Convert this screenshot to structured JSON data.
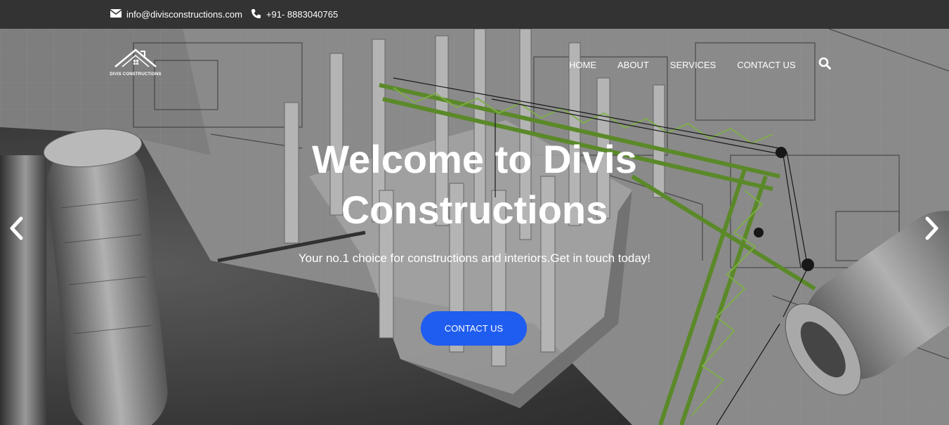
{
  "topbar": {
    "email": "info@divisconstructions.com",
    "phone": "+91- 8883040765",
    "email_icon": "envelope-icon",
    "phone_icon": "phone-icon"
  },
  "logo": {
    "text": "DIVIS CONSTRUCTIONS"
  },
  "nav": {
    "items": [
      "HOME",
      "ABOUT",
      "SERVICES",
      "CONTACT US"
    ],
    "search_icon": "search-icon"
  },
  "hero": {
    "title_line1": "Welcome to Divis",
    "title_line2": "Constructions",
    "subtitle": "Your no.1 choice for constructions and interiors.Get in touch today!",
    "cta_label": "CONTACT US",
    "prev_icon": "chevron-left-icon",
    "next_icon": "chevron-right-icon"
  },
  "colors": {
    "topbar_bg": "#333333",
    "cta_bg": "#1f5cf0",
    "crane_green": "#7cc43a"
  }
}
